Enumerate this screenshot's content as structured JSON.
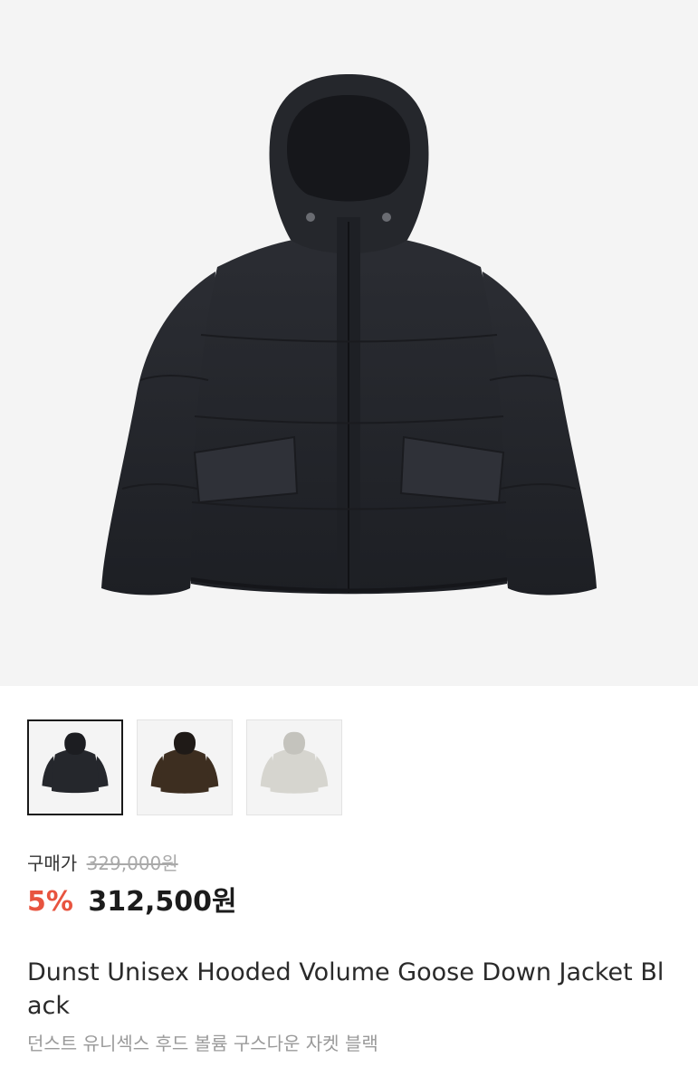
{
  "product": {
    "main_image": "black-puffer-jacket-photo",
    "thumbnails": [
      {
        "color": "black",
        "selected": true
      },
      {
        "color": "brown",
        "selected": false
      },
      {
        "color": "light-gray",
        "selected": false
      }
    ]
  },
  "price": {
    "purchase_label": "구매가",
    "original_price": "329,000원",
    "discount": "5%",
    "final_price": "312,500원"
  },
  "title": {
    "english": "Dunst Unisex Hooded Volume Goose Down Jacket Black",
    "korean": "던스트 유니섹스 후드 볼륨 구스다운 자켓 블랙"
  },
  "colors": {
    "discount": "#e8543f",
    "jacket_black": "#25272c",
    "jacket_brown": "#3d2e20",
    "jacket_lightgray": "#d6d5cf"
  }
}
